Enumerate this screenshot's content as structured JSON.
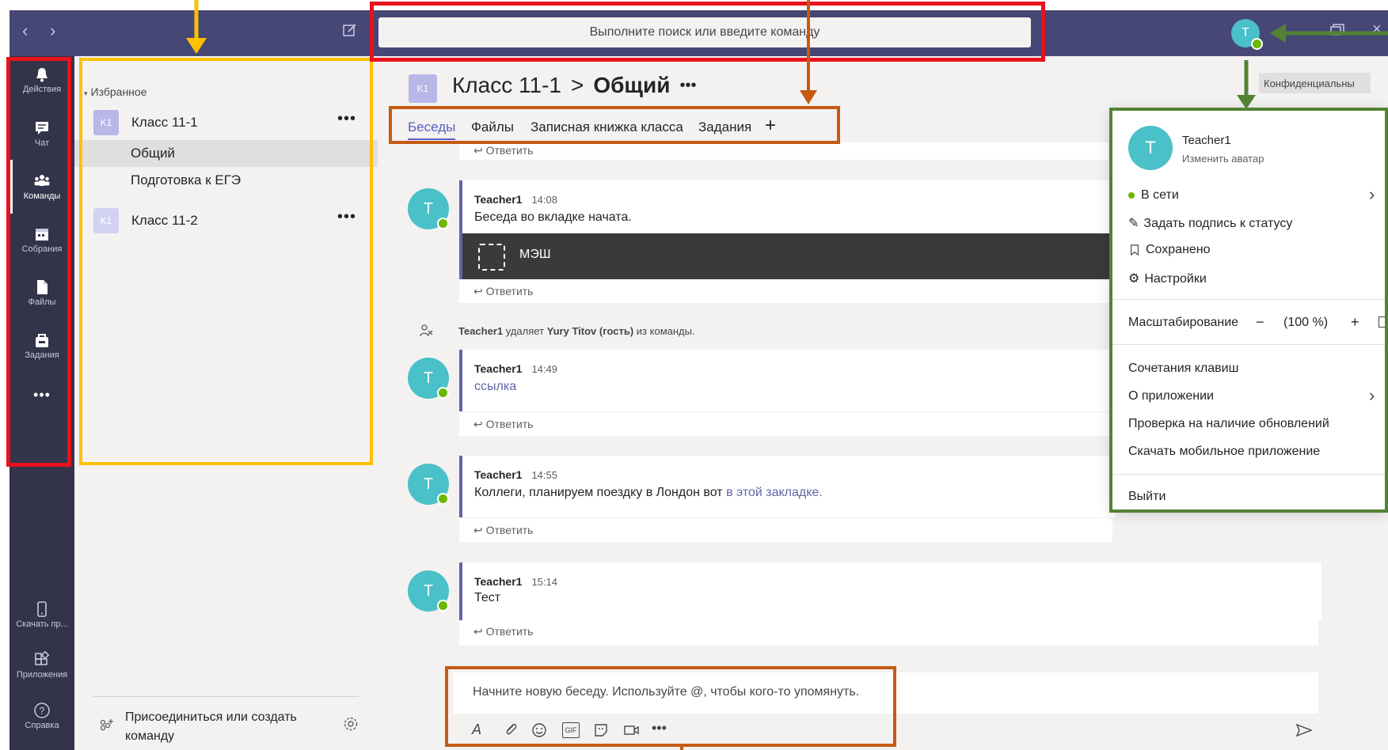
{
  "titlebar": {
    "search_placeholder": "Выполните поиск или введите команду",
    "avatar_initial": "T"
  },
  "rail": {
    "items": [
      {
        "label": "Действия",
        "icon": "bell-icon"
      },
      {
        "label": "Чат",
        "icon": "chat-icon"
      },
      {
        "label": "Команды",
        "icon": "teams-icon"
      },
      {
        "label": "Собрания",
        "icon": "calendar-icon"
      },
      {
        "label": "Файлы",
        "icon": "file-icon"
      },
      {
        "label": "Задания",
        "icon": "assignments-icon"
      }
    ],
    "more": "•••",
    "bottom": [
      {
        "label": "Скачать пр...",
        "icon": "phone-icon"
      },
      {
        "label": "Приложения",
        "icon": "apps-icon"
      },
      {
        "label": "Справка",
        "icon": "help-icon"
      }
    ]
  },
  "teams": {
    "favorites_label": "Избранное",
    "team1": {
      "badge": "K1",
      "name": "Класс 11-1",
      "channels": [
        "Общий",
        "Подготовка к ЕГЭ"
      ]
    },
    "team2": {
      "badge": "K1",
      "name": "Класс 11-2"
    },
    "more": "•••",
    "join_label": "Присоединиться или создать команду"
  },
  "channel": {
    "badge": "K1",
    "team": "Класс 11-1",
    "separator": ">",
    "name": "Общий",
    "more": "•••",
    "tabs": [
      "Беседы",
      "Файлы",
      "Записная книжка класса",
      "Задания"
    ],
    "add_tab": "+",
    "confidential": "Конфиденциальны"
  },
  "messages": {
    "reply_label": "Ответить",
    "m1": {
      "author": "Teacher1",
      "time": "14:08",
      "text": "Беседа во вкладке начата.",
      "card_title": "МЭШ"
    },
    "system": {
      "actor": "Teacher1",
      "verb": "удаляет",
      "target": "Yury Titov",
      "guest": "(гость)",
      "tail": "из команды."
    },
    "m2": {
      "author": "Teacher1",
      "time": "14:49",
      "link": "ссылка"
    },
    "m3": {
      "author": "Teacher1",
      "time": "14:55",
      "text": "Коллеги, планируем поездку в Лондон вот",
      "link": "в этой закладке."
    },
    "m4": {
      "author": "Teacher1",
      "time": "15:14",
      "text": "Тест"
    },
    "avatar_initial": "T"
  },
  "compose": {
    "placeholder": "Начните новую беседу. Используйте @, чтобы кого-то упомянуть.",
    "gif": "GIF",
    "more": "•••"
  },
  "profile_menu": {
    "avatar_initial": "T",
    "name": "Teacher1",
    "change_avatar": "Изменить аватар",
    "status": "В сети",
    "set_status": "Задать подпись к статусу",
    "saved": "Сохранено",
    "settings": "Настройки",
    "zoom_label": "Масштабирование",
    "zoom_minus": "−",
    "zoom_value": "(100 %)",
    "zoom_plus": "+",
    "shortcuts": "Сочетания клавиш",
    "about": "О приложении",
    "check_updates": "Проверка на наличие обновлений",
    "download_mobile": "Скачать мобильное приложение",
    "sign_out": "Выйти"
  },
  "colors": {
    "titlebar": "#464775",
    "rail": "#33344a",
    "accent": "#6264a7",
    "avatar": "#4ac0c8",
    "presence": "#6bb700",
    "annotation_red": "#e8111c",
    "annotation_yellow": "#ffc000",
    "annotation_orange": "#c55a11",
    "annotation_green": "#548235"
  }
}
